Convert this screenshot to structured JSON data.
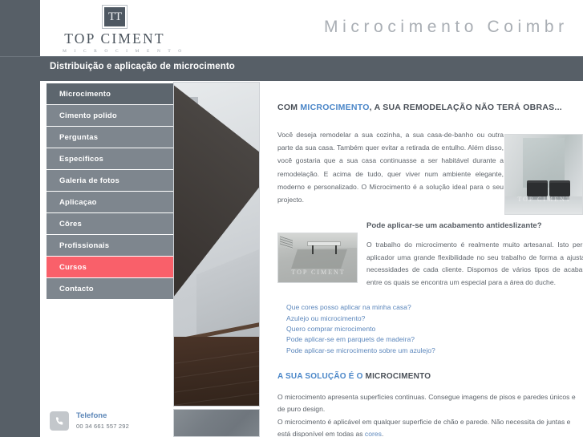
{
  "header": {
    "logo": {
      "monogram": "TT",
      "name": "TOP CIMENT",
      "subtitle": "M I C R O C I M E N T O"
    },
    "site_title": "Microcimento Coimbr",
    "tagline": "Distribuição e aplicação de microcimento"
  },
  "sidebar": {
    "items": [
      {
        "label": "Microcimento",
        "state": "active-dark"
      },
      {
        "label": "Cimento polido",
        "state": "normal"
      },
      {
        "label": "Perguntas",
        "state": "normal"
      },
      {
        "label": "Especificos",
        "state": "normal"
      },
      {
        "label": "Galeria de fotos",
        "state": "normal"
      },
      {
        "label": "Aplicaçao",
        "state": "normal"
      },
      {
        "label": "Côres",
        "state": "normal"
      },
      {
        "label": "Profissionais",
        "state": "normal"
      },
      {
        "label": "Cursos",
        "state": "active-red"
      },
      {
        "label": "Contacto",
        "state": "normal"
      }
    ]
  },
  "contact": {
    "icon": "phone-icon",
    "label": "Telefone",
    "number": "00 34 661 557 292"
  },
  "main": {
    "heading_pre": "COM ",
    "heading_accent": "MICROCIMENTO",
    "heading_post": ", A SUA REMODELAÇÃO NÃO TERÁ OBRAS...",
    "intro_paragraph": "Você deseja remodelar a sua cozinha, a sua casa-de-banho ou outra parte da sua casa. Também quer evitar a retirada de entulho. Além disso, você gostaria que a sua casa continuasse a ser habitável durante a remodelação. E acima de tudo, quer viver num ambiente elegante, moderno e personalizado. O Microcimento é a solução ideal para o seu projecto.",
    "section2_heading": "Pode aplicar-se um acabamento antideslizante?",
    "section2_paragraph": "O trabalho do microcimento é realmente muito artesanal. Isto permite ao aplicador uma grande flexibilidade no seu trabalho de forma a ajustar-se às necessidades de cada cliente. Dispomos de vários tipos de acabamentos, entre os quais se encontra um especial para a área do duche.",
    "links": [
      "Que cores posso aplicar na minha casa?",
      "Azulejo ou microcimento?",
      "Quero comprar microcimento",
      "Pode aplicar-se em parquets de madeira?",
      "Pode aplicar-se microcimento sobre um azulejo?"
    ],
    "solution_heading_blue": "A SUA SOLUÇÃO É O ",
    "solution_heading_gray": "MICROCIMENTO",
    "solution_p1": "O microcimento apresenta superficies continuas. Consegue imagens de pisos e paredes únicos e de puro design.",
    "solution_p2_a": "O microcimento é aplicável em qualquer superficie de chão e parede. Não necessita de juntas e está disponível em todas as ",
    "solution_p2_link": "cores",
    "solution_p2_b": "."
  },
  "photos": {
    "stairs_alt": "microcement-staircase-photo",
    "swatch_alt": "microcement-color-swatch",
    "room_watermark": "TOP CIMENT",
    "floor_watermark": "TOP CIMENT"
  },
  "colors": {
    "dark_slate": "#575f67",
    "nav_gray": "#7e868e",
    "nav_active_red": "#f9606a",
    "link_blue": "#5c87bc",
    "accent_blue": "#4a86c8"
  }
}
